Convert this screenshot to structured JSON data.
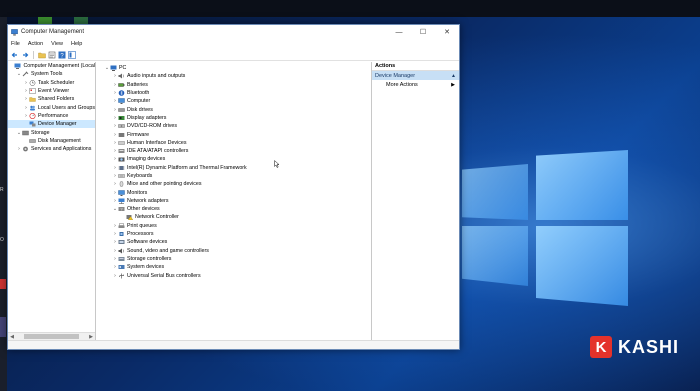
{
  "window": {
    "title": "Computer Management",
    "controls": {
      "minimize": "—",
      "maximize": "☐",
      "close": "✕"
    }
  },
  "menu": [
    "File",
    "Action",
    "View",
    "Help"
  ],
  "toolbar_icons": [
    "back-icon",
    "forward-icon",
    "folder-icon",
    "properties-icon",
    "help-icon",
    "details-icon"
  ],
  "left_tree": [
    {
      "label": "Computer Management (Local",
      "level": 0,
      "arrow": "",
      "icon": "computer-management-icon"
    },
    {
      "label": "System Tools",
      "level": 1,
      "arrow": "⌄",
      "icon": "tools-icon"
    },
    {
      "label": "Task Scheduler",
      "level": 2,
      "arrow": "›",
      "icon": "clock-icon"
    },
    {
      "label": "Event Viewer",
      "level": 2,
      "arrow": "›",
      "icon": "event-viewer-icon"
    },
    {
      "label": "Shared Folders",
      "level": 2,
      "arrow": "›",
      "icon": "shared-folder-icon"
    },
    {
      "label": "Local Users and Groups",
      "level": 2,
      "arrow": "›",
      "icon": "users-icon"
    },
    {
      "label": "Performance",
      "level": 2,
      "arrow": "›",
      "icon": "performance-icon"
    },
    {
      "label": "Device Manager",
      "level": 2,
      "arrow": "",
      "icon": "device-manager-icon",
      "selected": true
    },
    {
      "label": "Storage",
      "level": 1,
      "arrow": "⌄",
      "icon": "storage-icon"
    },
    {
      "label": "Disk Management",
      "level": 2,
      "arrow": "",
      "icon": "disk-icon"
    },
    {
      "label": "Services and Applications",
      "level": 1,
      "arrow": "›",
      "icon": "services-icon"
    }
  ],
  "device_tree": [
    {
      "label": "PC",
      "level": 0,
      "arrow": "⌄",
      "icon": "computer-icon"
    },
    {
      "label": "Audio inputs and outputs",
      "level": 1,
      "arrow": "›",
      "icon": "speaker-icon"
    },
    {
      "label": "Batteries",
      "level": 1,
      "arrow": "›",
      "icon": "battery-icon"
    },
    {
      "label": "Bluetooth",
      "level": 1,
      "arrow": "›",
      "icon": "bluetooth-icon"
    },
    {
      "label": "Computer",
      "level": 1,
      "arrow": "›",
      "icon": "monitor-icon"
    },
    {
      "label": "Disk drives",
      "level": 1,
      "arrow": "›",
      "icon": "disk-drive-icon"
    },
    {
      "label": "Display adapters",
      "level": 1,
      "arrow": "›",
      "icon": "display-adapter-icon"
    },
    {
      "label": "DVD/CD-ROM drives",
      "level": 1,
      "arrow": "›",
      "icon": "dvd-icon"
    },
    {
      "label": "Firmware",
      "level": 1,
      "arrow": "›",
      "icon": "firmware-icon"
    },
    {
      "label": "Human Interface Devices",
      "level": 1,
      "arrow": "›",
      "icon": "hid-icon"
    },
    {
      "label": "IDE ATA/ATAPI controllers",
      "level": 1,
      "arrow": "›",
      "icon": "ide-icon"
    },
    {
      "label": "Imaging devices",
      "level": 1,
      "arrow": "›",
      "icon": "camera-icon"
    },
    {
      "label": "Intel(R) Dynamic Platform and Thermal Framework",
      "level": 1,
      "arrow": "›",
      "icon": "chip-icon"
    },
    {
      "label": "Keyboards",
      "level": 1,
      "arrow": "›",
      "icon": "keyboard-icon"
    },
    {
      "label": "Mice and other pointing devices",
      "level": 1,
      "arrow": "›",
      "icon": "mouse-icon"
    },
    {
      "label": "Monitors",
      "level": 1,
      "arrow": "›",
      "icon": "monitor-icon"
    },
    {
      "label": "Network adapters",
      "level": 1,
      "arrow": "›",
      "icon": "network-icon"
    },
    {
      "label": "Other devices",
      "level": 1,
      "arrow": "⌄",
      "icon": "other-devices-icon"
    },
    {
      "label": "Network Controller",
      "level": 2,
      "arrow": "",
      "icon": "warning-device-icon"
    },
    {
      "label": "Print queues",
      "level": 1,
      "arrow": "›",
      "icon": "printer-icon"
    },
    {
      "label": "Processors",
      "level": 1,
      "arrow": "›",
      "icon": "processor-icon"
    },
    {
      "label": "Software devices",
      "level": 1,
      "arrow": "›",
      "icon": "software-device-icon"
    },
    {
      "label": "Sound, video and game controllers",
      "level": 1,
      "arrow": "›",
      "icon": "sound-icon"
    },
    {
      "label": "Storage controllers",
      "level": 1,
      "arrow": "›",
      "icon": "storage-controller-icon"
    },
    {
      "label": "System devices",
      "level": 1,
      "arrow": "›",
      "icon": "system-devices-icon"
    },
    {
      "label": "Universal Serial Bus controllers",
      "level": 1,
      "arrow": "›",
      "icon": "usb-icon"
    }
  ],
  "actions": {
    "header": "Actions",
    "section": "Device Manager",
    "section_arrow": "▲",
    "more": "More Actions",
    "more_arrow": "▶"
  },
  "watermark": {
    "logo_letter": "K",
    "text": "KASHI"
  },
  "colors": {
    "selection": "#cce8ff",
    "actions_section": "#c7dff5",
    "watermark_red": "#e4322b",
    "icon_blue": "#2e6fc2"
  }
}
